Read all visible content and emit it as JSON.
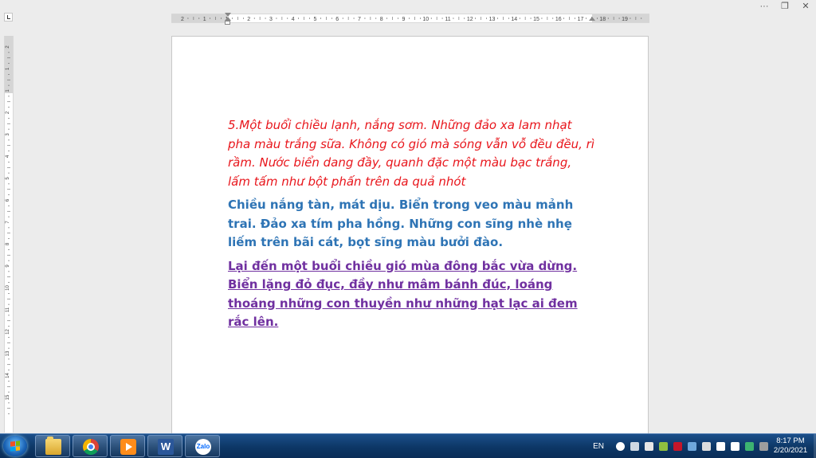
{
  "window": {
    "controls": [
      {
        "name": "more-options",
        "glyph": "···"
      },
      {
        "name": "restore",
        "glyph": "❐"
      },
      {
        "name": "close",
        "glyph": "✕"
      }
    ]
  },
  "ruler": {
    "horizontal_labels": [
      "2",
      "1",
      "1",
      "2",
      "3",
      "4",
      "5",
      "6",
      "7",
      "8",
      "9",
      "10",
      "11",
      "12",
      "13",
      "14",
      "15",
      "16",
      "17",
      "18",
      "19"
    ],
    "vertical_labels": [
      "2",
      "1",
      "1",
      "2",
      "3",
      "4",
      "5",
      "6",
      "7",
      "8",
      "9",
      "10",
      "11",
      "12",
      "13",
      "14",
      "15"
    ]
  },
  "document": {
    "paragraphs": [
      {
        "style": "red-italic",
        "text": "5.Một buổi chiều lạnh, nắng sơm. Những đảo xa lam nhạt pha màu trắng sữa. Không có gió mà sóng vẫn vỗ đều đều, rì rầm. Nước biển dang đầy, quanh đặc một màu bạc trắng, lấm tấm như bột phấn trên da quả nhót"
      },
      {
        "style": "blue-bold",
        "text": "Chiều nắng tàn, mát dịu. Biển trong veo màu mảnh trai. Đảo xa tím pha hồng. Những con sĩng nhè nhẹ liếm trên bãi cát, bọt sĩng màu bưởi đào."
      },
      {
        "style": "purple-bold-underline",
        "text": "Lại đến một buổi chiều gió mùa đông bắc vừa dừng. Biển lặng đỏ đục, đầy như mâm bánh đúc, loáng thoáng những con thuyền như những hạt lạc ai đem rắc lên."
      }
    ]
  },
  "taskbar": {
    "apps": [
      {
        "name": "explorer",
        "icon": "folder-icon"
      },
      {
        "name": "chrome",
        "icon": "chrome-icon"
      },
      {
        "name": "media-player",
        "icon": "media-player-icon"
      },
      {
        "name": "word",
        "icon": "word-icon",
        "label": "W"
      },
      {
        "name": "zalo",
        "icon": "zalo-icon",
        "label": "Zalo"
      }
    ],
    "language": "EN",
    "clock": {
      "time": "8:17 PM",
      "date": "2/20/2021"
    }
  },
  "colors": {
    "red_text": "#e8161c",
    "blue_text": "#2e74b5",
    "purple_text": "#7030a0",
    "taskbar": "#0d3766"
  }
}
